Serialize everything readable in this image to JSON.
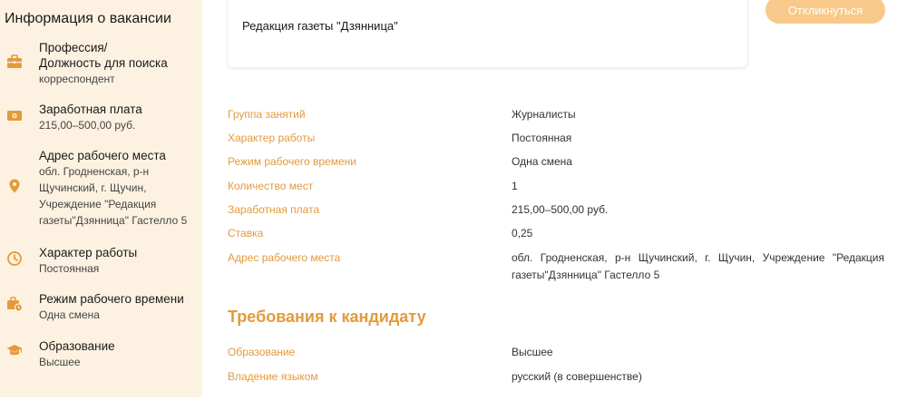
{
  "sidebar": {
    "title": "Информация о вакансии",
    "items": [
      {
        "label": "Профессия/\nДолжность для поиска",
        "value": "корреспондент",
        "icon": "briefcase-icon"
      },
      {
        "label": "Заработная плата",
        "value": "215,00–500,00 руб.",
        "icon": "money-icon"
      },
      {
        "label": "Адрес рабочего места",
        "value": "обл. Гродненская, р-н\nЩучинский, г. Щучин,\nУчреждение \"Редакция\nгазеты\"Дзянница\" Гастелло 5",
        "icon": "location-pin-icon"
      },
      {
        "label": "Характер работы",
        "value": "Постоянная",
        "icon": "clock-icon"
      },
      {
        "label": "Режим рабочего времени",
        "value": "Одна смена",
        "icon": "briefcase-clock-icon"
      },
      {
        "label": "Образование",
        "value": "Высшее",
        "icon": "graduation-cap-icon"
      }
    ]
  },
  "card": {
    "text": "Редакция газеты \"Дзянница\""
  },
  "respond_button": {
    "label": "Откликнуться"
  },
  "details": [
    {
      "label": "Группа занятий",
      "value": "Журналисты"
    },
    {
      "label": "Характер работы",
      "value": "Постоянная"
    },
    {
      "label": "Режим рабочего времени",
      "value": "Одна смена"
    },
    {
      "label": "Количество мест",
      "value": "1"
    },
    {
      "label": "Заработная плата",
      "value": "215,00–500,00 руб."
    },
    {
      "label": "Ставка",
      "value": "0,25"
    },
    {
      "label": "Адрес рабочего места",
      "value": "обл. Гродненская, р-н Щучинский, г. Щучин, Учреждение \"Редакция газеты\"Дзянница\" Гастелло 5"
    }
  ],
  "requirements": {
    "title": "Требования к кандидату",
    "rows": [
      {
        "label": "Образование",
        "value": "Высшее"
      },
      {
        "label": "Владение языком",
        "value": "русский (в совершенстве)"
      }
    ]
  },
  "colors": {
    "accent": "#e39a3c",
    "sidebar_bg": "#fdf2e1",
    "button_bg": "#f8c98a"
  }
}
